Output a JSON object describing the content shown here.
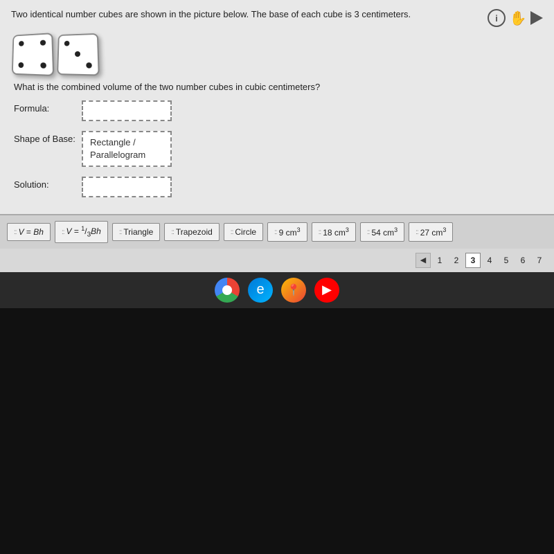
{
  "header": {
    "question": "Two identical number cubes are shown in the picture below. The base of each cube is 3 centimeters.",
    "icons": {
      "info_label": "i",
      "hand_label": "✋",
      "play_label": "▶"
    }
  },
  "sub_question": "What is the combined volume of the two number cubes in cubic centimeters?",
  "fields": {
    "formula_label": "Formula:",
    "formula_value": "",
    "shape_label": "Shape of Base:",
    "shape_value": "Rectangle /\nParallelogram",
    "solution_label": "Solution:",
    "solution_value": ""
  },
  "tiles": [
    {
      "id": "tile-v-bh",
      "label": "V = Bh"
    },
    {
      "id": "tile-v-1-3-bh",
      "label": "V = ¹⁄₃Bh"
    },
    {
      "id": "tile-triangle",
      "label": "Triangle"
    },
    {
      "id": "tile-trapezoid",
      "label": "Trapezoid"
    },
    {
      "id": "tile-circle",
      "label": "Circle"
    },
    {
      "id": "tile-9cm3",
      "label": "9 cm³"
    },
    {
      "id": "tile-18cm3",
      "label": "18 cm³"
    },
    {
      "id": "tile-54cm3",
      "label": "54 cm³"
    },
    {
      "id": "tile-27cm3",
      "label": "27 cm³"
    }
  ],
  "pagination": {
    "prev_label": "◀",
    "pages": [
      "1",
      "2",
      "3",
      "4",
      "5",
      "6",
      "7"
    ],
    "active_page": "3"
  },
  "taskbar": {
    "icons": [
      {
        "id": "chrome",
        "label": "Chrome"
      },
      {
        "id": "edge",
        "label": "Edge"
      },
      {
        "id": "maps",
        "label": "Maps"
      },
      {
        "id": "youtube",
        "label": "YouTube"
      }
    ]
  }
}
